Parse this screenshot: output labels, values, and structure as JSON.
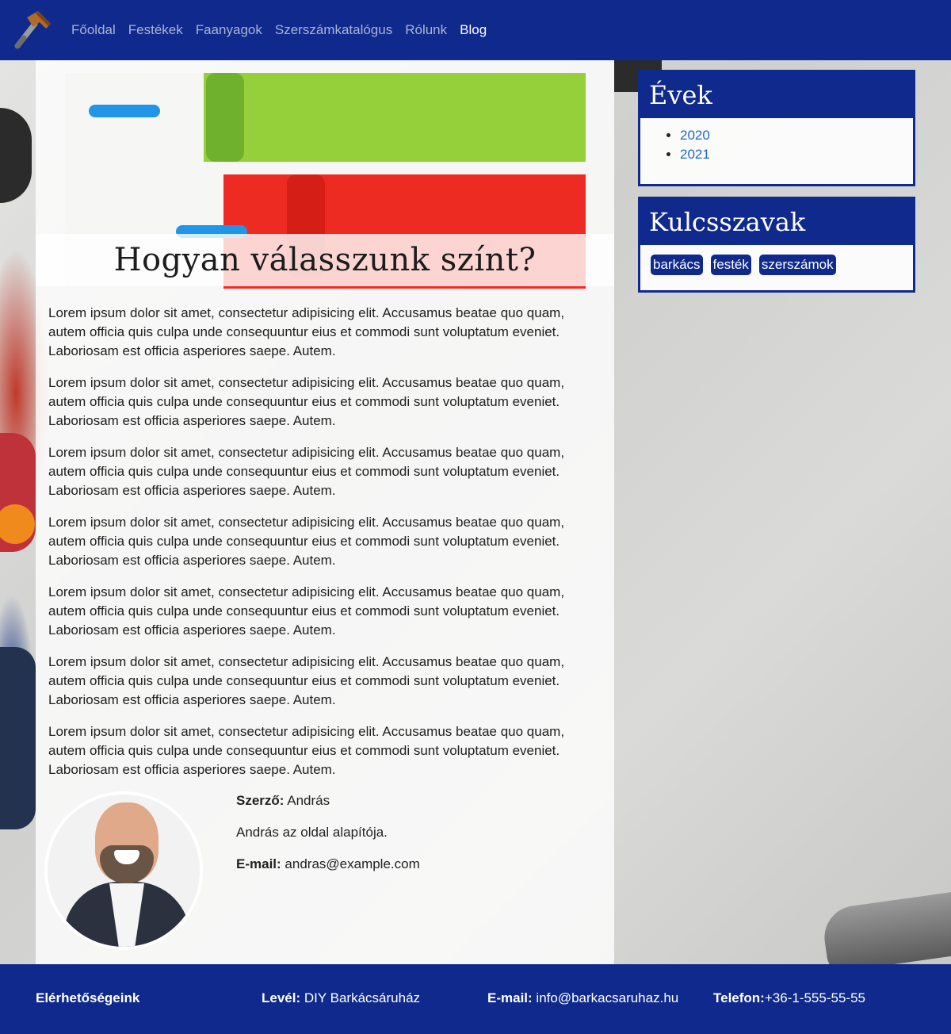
{
  "nav": {
    "items": [
      {
        "label": "Főoldal",
        "active": false
      },
      {
        "label": "Festékek",
        "active": false
      },
      {
        "label": "Faanyagok",
        "active": false
      },
      {
        "label": "Szerszámkatalógus",
        "active": false
      },
      {
        "label": "Rólunk",
        "active": false
      },
      {
        "label": "Blog",
        "active": true
      }
    ],
    "logo_icon": "hammer-icon"
  },
  "post": {
    "title": "Hogyan válasszunk színt?",
    "paragraphs": [
      "Lorem ipsum dolor sit amet, consectetur adipisicing elit. Accusamus beatae quo quam, autem officia quis culpa unde consequuntur eius et commodi sunt voluptatum eveniet. Laboriosam est officia asperiores saepe. Autem.",
      "Lorem ipsum dolor sit amet, consectetur adipisicing elit. Accusamus beatae quo quam, autem officia quis culpa unde consequuntur eius et commodi sunt voluptatum eveniet. Laboriosam est officia asperiores saepe. Autem.",
      "Lorem ipsum dolor sit amet, consectetur adipisicing elit. Accusamus beatae quo quam, autem officia quis culpa unde consequuntur eius et commodi sunt voluptatum eveniet. Laboriosam est officia asperiores saepe. Autem.",
      "Lorem ipsum dolor sit amet, consectetur adipisicing elit. Accusamus beatae quo quam, autem officia quis culpa unde consequuntur eius et commodi sunt voluptatum eveniet. Laboriosam est officia asperiores saepe. Autem.",
      "Lorem ipsum dolor sit amet, consectetur adipisicing elit. Accusamus beatae quo quam, autem officia quis culpa unde consequuntur eius et commodi sunt voluptatum eveniet. Laboriosam est officia asperiores saepe. Autem.",
      "Lorem ipsum dolor sit amet, consectetur adipisicing elit. Accusamus beatae quo quam, autem officia quis culpa unde consequuntur eius et commodi sunt voluptatum eveniet. Laboriosam est officia asperiores saepe. Autem.",
      "Lorem ipsum dolor sit amet, consectetur adipisicing elit. Accusamus beatae quo quam, autem officia quis culpa unde consequuntur eius et commodi sunt voluptatum eveniet. Laboriosam est officia asperiores saepe. Autem."
    ],
    "author": {
      "label": "Szerző:",
      "name": "András",
      "bio": "András az oldal alapítója.",
      "email_label": "E-mail:",
      "email": "andras@example.com"
    }
  },
  "sidebar": {
    "years": {
      "title": "Évek",
      "items": [
        "2020",
        "2021"
      ]
    },
    "keywords": {
      "title": "Kulcsszavak",
      "items": [
        "barkács",
        "festék",
        "szerszámok"
      ]
    }
  },
  "footer": {
    "heading": "Elérhetőségeink",
    "mail_label": "Levél:",
    "mail_value": "DIY Barkácsáruház",
    "email_label": "E-mail:",
    "email_value": "info@barkacsaruhaz.hu",
    "phone_label": "Telefon:",
    "phone_value": "+36-1-555-55-55"
  },
  "colors": {
    "brand": "#0f2a8c",
    "link": "#1a67cf",
    "paint_green": "#95cf3a",
    "paint_red": "#ee2b22"
  }
}
